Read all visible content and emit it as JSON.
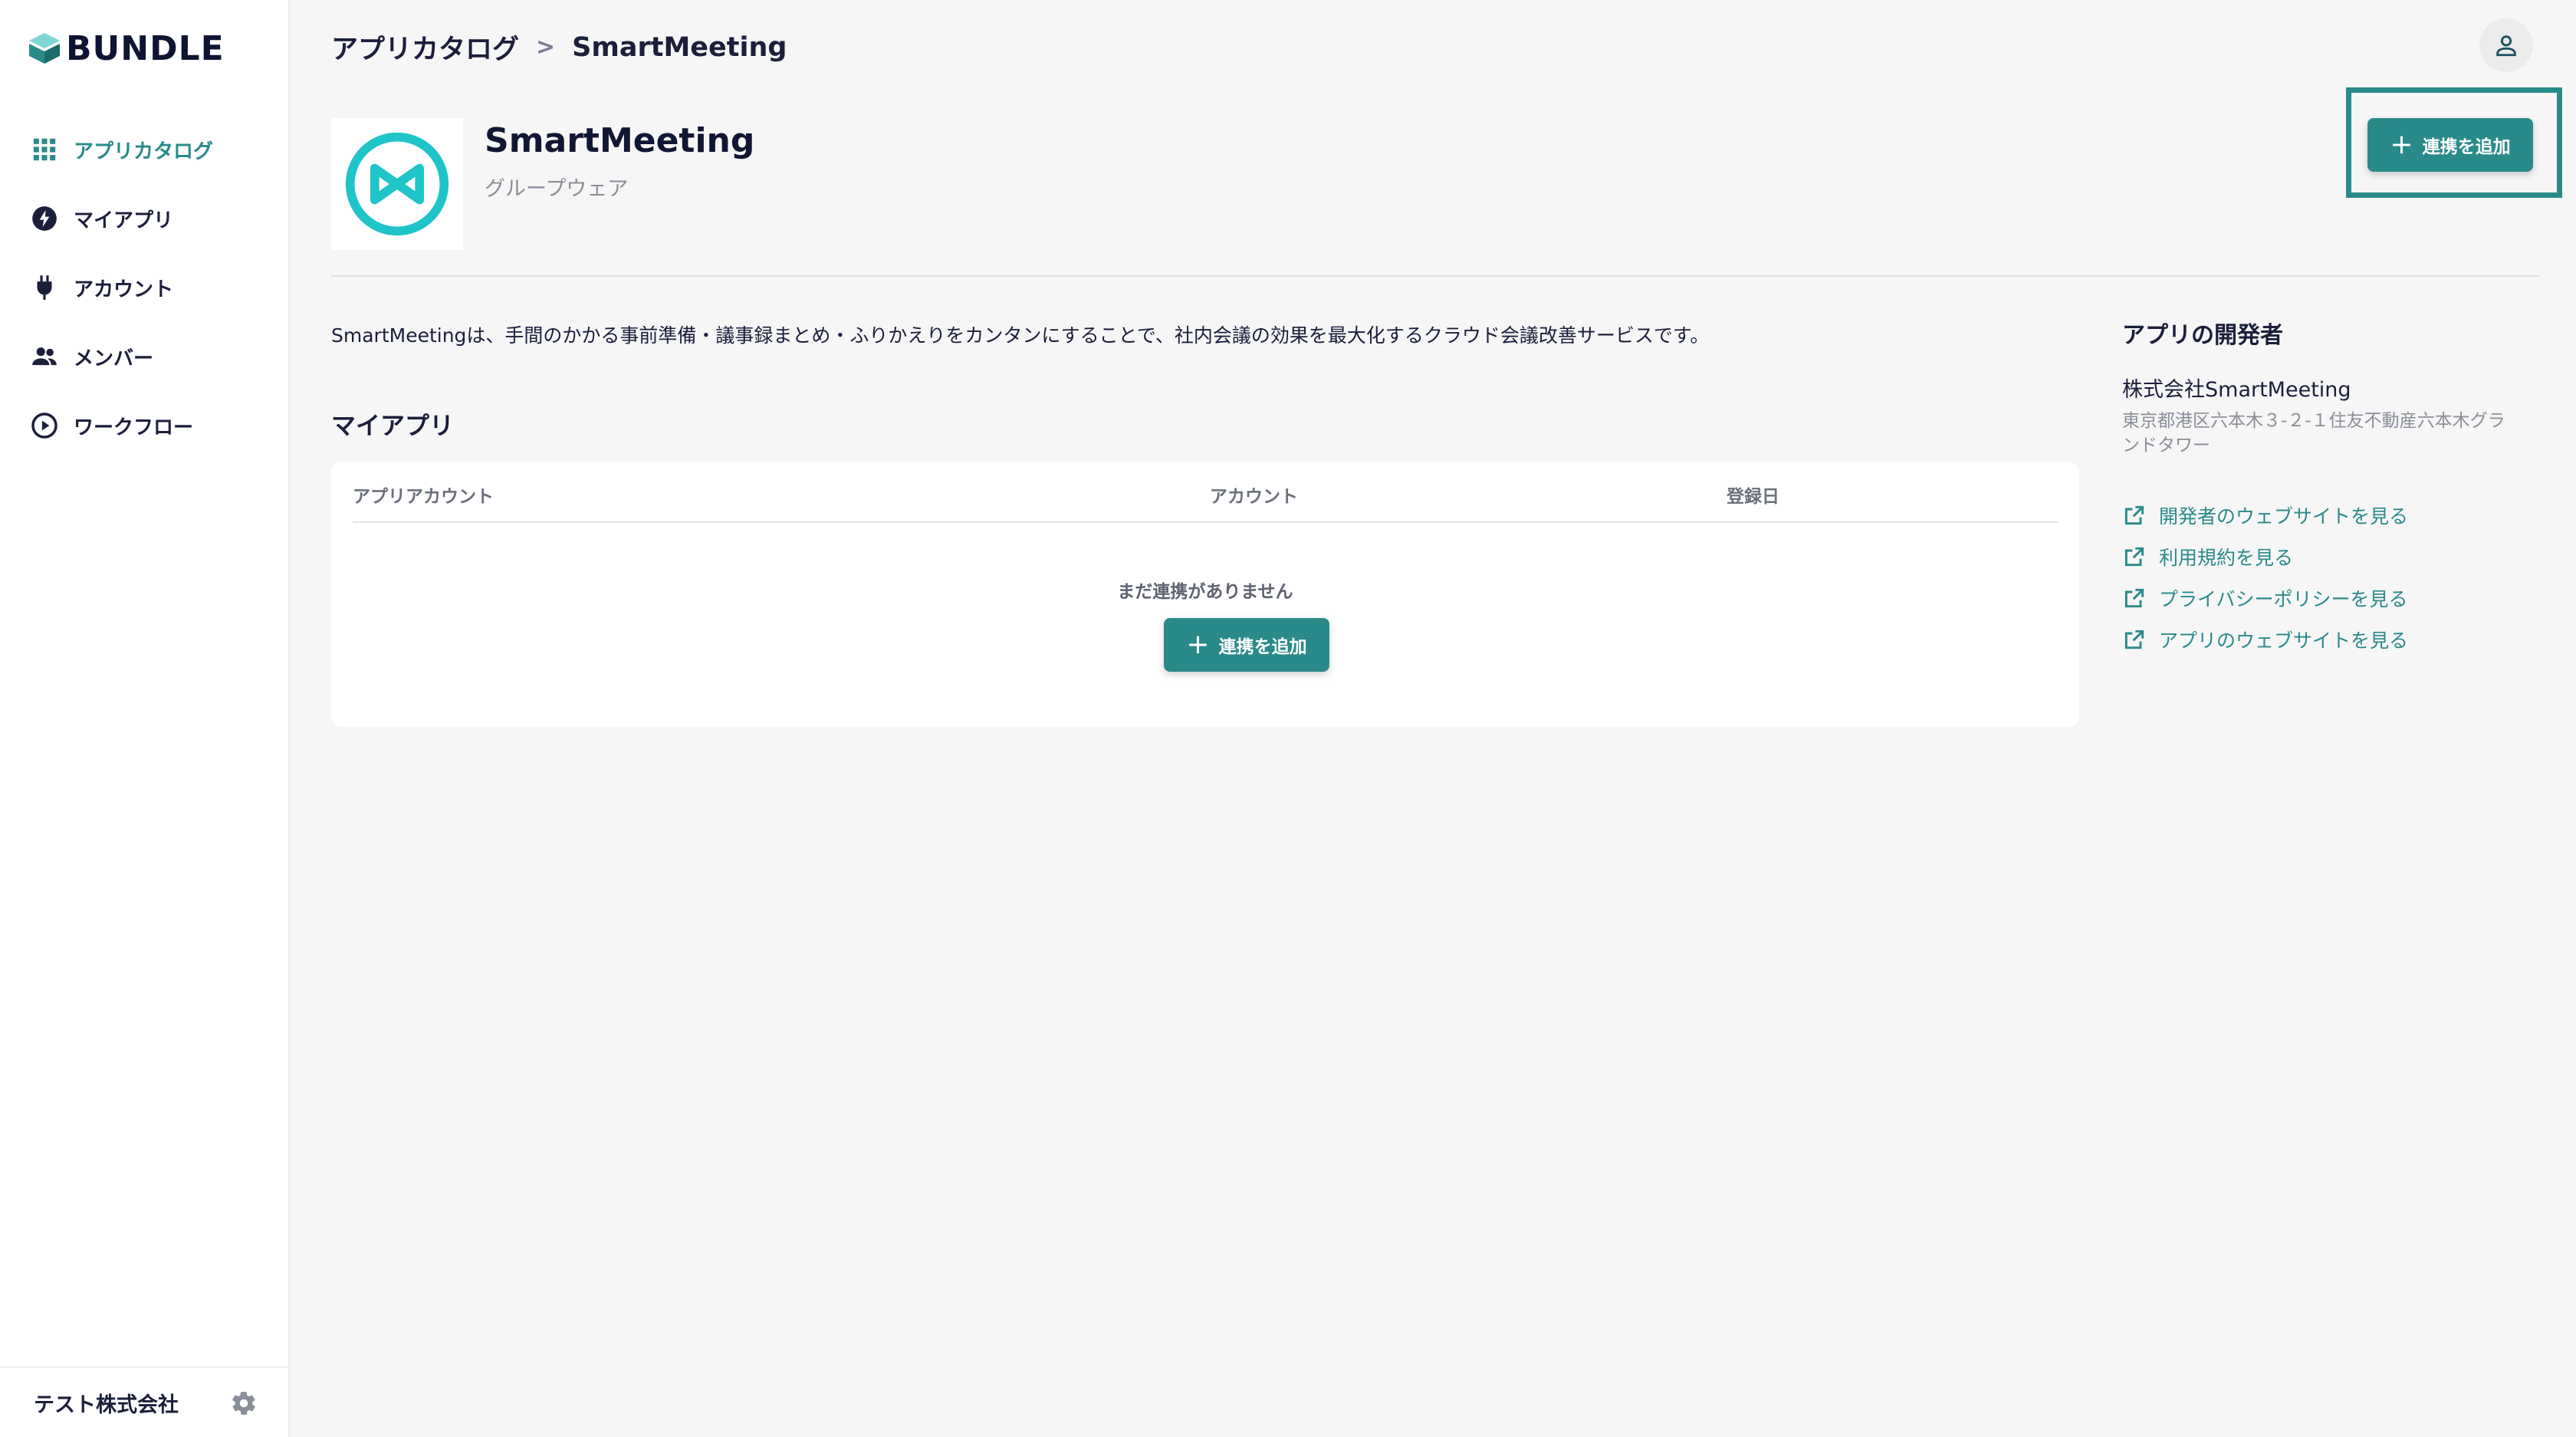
{
  "brand": {
    "name": "BUNDLE"
  },
  "sidebar": {
    "items": [
      {
        "label": "アプリカタログ",
        "icon": "grid-icon",
        "active": true
      },
      {
        "label": "マイアプリ",
        "icon": "lightning-icon",
        "active": false
      },
      {
        "label": "アカウント",
        "icon": "plug-icon",
        "active": false
      },
      {
        "label": "メンバー",
        "icon": "people-icon",
        "active": false
      },
      {
        "label": "ワークフロー",
        "icon": "play-circle-icon",
        "active": false
      }
    ],
    "footer": {
      "org_name": "テスト株式会社",
      "settings_icon": "gear-icon"
    }
  },
  "breadcrumb": {
    "parent": "アプリカタログ",
    "separator": ">",
    "current": "SmartMeeting"
  },
  "app": {
    "name": "SmartMeeting",
    "category": "グループウェア",
    "description": "SmartMeetingは、手間のかかる事前準備・議事録まとめ・ふりかえりをカンタンにすることで、社内会議の効果を最大化するクラウド会議改善サービスです。"
  },
  "actions": {
    "add_connection_label": "連携を追加",
    "plus_symbol": "+"
  },
  "my_apps": {
    "title": "マイアプリ",
    "columns": [
      "アプリアカウント",
      "アカウント",
      "登録日"
    ],
    "empty_message": "まだ連携がありません",
    "rows": []
  },
  "developer": {
    "title": "アプリの開発者",
    "company": "株式会社SmartMeeting",
    "address": "東京都港区六本木３-２-１住友不動産六本木グランドタワー",
    "links": [
      {
        "label": "開発者のウェブサイトを見る"
      },
      {
        "label": "利用規約を見る"
      },
      {
        "label": "プライバシーポリシーを見る"
      },
      {
        "label": "アプリのウェブサイトを見る"
      }
    ]
  },
  "colors": {
    "accent": "#2a8a8a",
    "app_logo": "#1fc4c9",
    "text": "#1b1f3a",
    "muted": "#8a8e99",
    "background": "#f6f6f6"
  }
}
